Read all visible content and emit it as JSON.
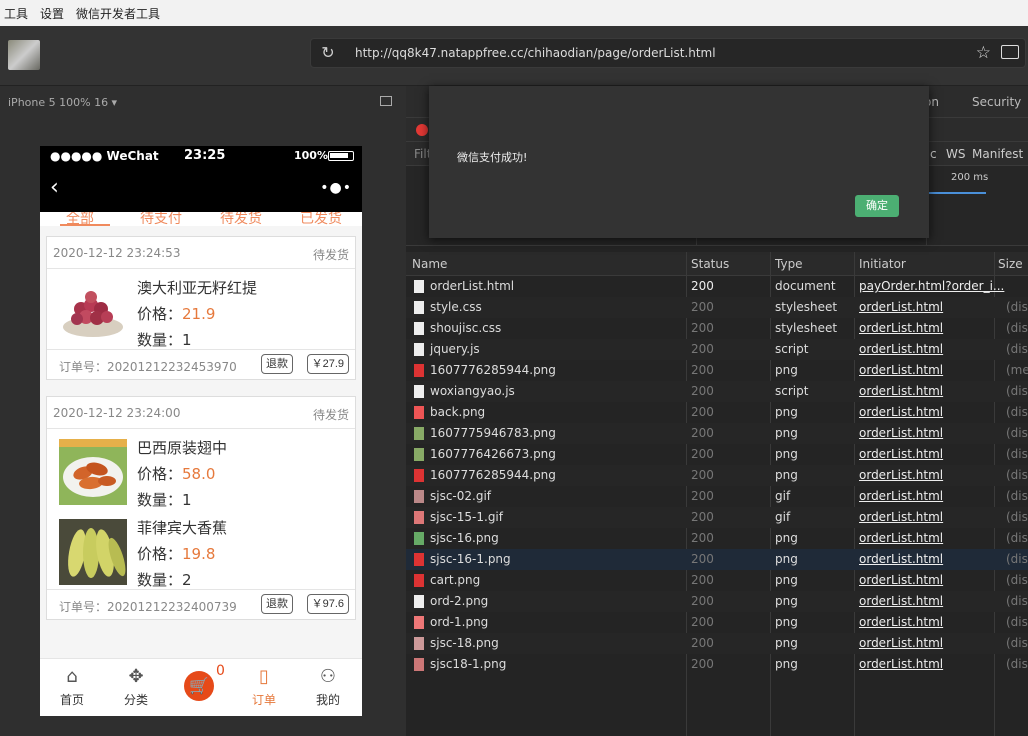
{
  "menu": [
    "工具",
    "设置",
    "微信开发者工具"
  ],
  "url": "http://qq8k47.natappfree.cc/chihaodian/page/orderList.html",
  "simulator": {
    "device": "iPhone 5 100% 16 ▾",
    "status_bar": {
      "carrier": "●●●●● WeChat",
      "time": "23:25",
      "battery": "100%"
    },
    "tabs": [
      "全部",
      "待支付",
      "待发货",
      "已发货"
    ],
    "orders": [
      {
        "time": "2020-12-12 23:24:53",
        "status": "待发货",
        "goods": [
          {
            "name": "澳大利亚无籽红提",
            "price_label": "价格：",
            "price": "21.9",
            "qty": "数量：1"
          }
        ],
        "order_no": "订单号：20201212232453970",
        "refund": "退款",
        "total": "￥27.9"
      },
      {
        "time": "2020-12-12 23:24:00",
        "status": "待发货",
        "goods": [
          {
            "name": "巴西原装翅中",
            "price_label": "价格：",
            "price": "58.0",
            "qty": "数量：1"
          },
          {
            "name": "菲律宾大香蕉",
            "price_label": "价格：",
            "price": "19.8",
            "qty": "数量：2"
          }
        ],
        "order_no": "订单号：20201212232400739",
        "refund": "退款",
        "total": "￥97.6"
      }
    ],
    "tabbar": {
      "home": "首页",
      "category": "分类",
      "cart_count": "0",
      "orders": "订单",
      "mine": "我的"
    }
  },
  "devtools": {
    "tabs": [
      "tion",
      "Security"
    ],
    "filter_placeholder": "Filt",
    "filter_tabs": [
      "c",
      "WS",
      "Manifest"
    ],
    "timeline_label": "200 ms",
    "columns": [
      "Name",
      "Status",
      "Type",
      "Initiator",
      "Size"
    ],
    "rows": [
      {
        "name": "orderList.html",
        "status": "200",
        "type": "document",
        "initiator": "payOrder.html?order_i...",
        "size": ""
      },
      {
        "name": "style.css",
        "status": "200",
        "type": "stylesheet",
        "initiator": "orderList.html",
        "size": "(dis"
      },
      {
        "name": "shoujisc.css",
        "status": "200",
        "type": "stylesheet",
        "initiator": "orderList.html",
        "size": "(dis"
      },
      {
        "name": "jquery.js",
        "status": "200",
        "type": "script",
        "initiator": "orderList.html",
        "size": "(dis"
      },
      {
        "name": "1607776285944.png",
        "status": "200",
        "type": "png",
        "initiator": "orderList.html",
        "size": "(mem"
      },
      {
        "name": "woxiangyao.js",
        "status": "200",
        "type": "script",
        "initiator": "orderList.html",
        "size": "(dis"
      },
      {
        "name": "back.png",
        "status": "200",
        "type": "png",
        "initiator": "orderList.html",
        "size": "(dis"
      },
      {
        "name": "1607775946783.png",
        "status": "200",
        "type": "png",
        "initiator": "orderList.html",
        "size": "(dis"
      },
      {
        "name": "1607776426673.png",
        "status": "200",
        "type": "png",
        "initiator": "orderList.html",
        "size": "(dis"
      },
      {
        "name": "1607776285944.png",
        "status": "200",
        "type": "png",
        "initiator": "orderList.html",
        "size": "(dis"
      },
      {
        "name": "sjsc-02.gif",
        "status": "200",
        "type": "gif",
        "initiator": "orderList.html",
        "size": "(dis"
      },
      {
        "name": "sjsc-15-1.gif",
        "status": "200",
        "type": "gif",
        "initiator": "orderList.html",
        "size": "(dis"
      },
      {
        "name": "sjsc-16.png",
        "status": "200",
        "type": "png",
        "initiator": "orderList.html",
        "size": "(dis"
      },
      {
        "name": "sjsc-16-1.png",
        "status": "200",
        "type": "png",
        "initiator": "orderList.html",
        "size": "(dis"
      },
      {
        "name": "cart.png",
        "status": "200",
        "type": "png",
        "initiator": "orderList.html",
        "size": "(dis"
      },
      {
        "name": "ord-2.png",
        "status": "200",
        "type": "png",
        "initiator": "orderList.html",
        "size": "(dis"
      },
      {
        "name": "ord-1.png",
        "status": "200",
        "type": "png",
        "initiator": "orderList.html",
        "size": "(dis"
      },
      {
        "name": "sjsc-18.png",
        "status": "200",
        "type": "png",
        "initiator": "orderList.html",
        "size": "(dis"
      },
      {
        "name": "sjsc18-1.png",
        "status": "200",
        "type": "png",
        "initiator": "orderList.html",
        "size": "(dis"
      }
    ]
  },
  "dialog": {
    "message": "微信支付成功!",
    "ok": "确定"
  },
  "colors": {
    "accent": "#f08a5d",
    "price": "#e6793c",
    "ok_button": "#4caf73",
    "record": "#e53935"
  }
}
